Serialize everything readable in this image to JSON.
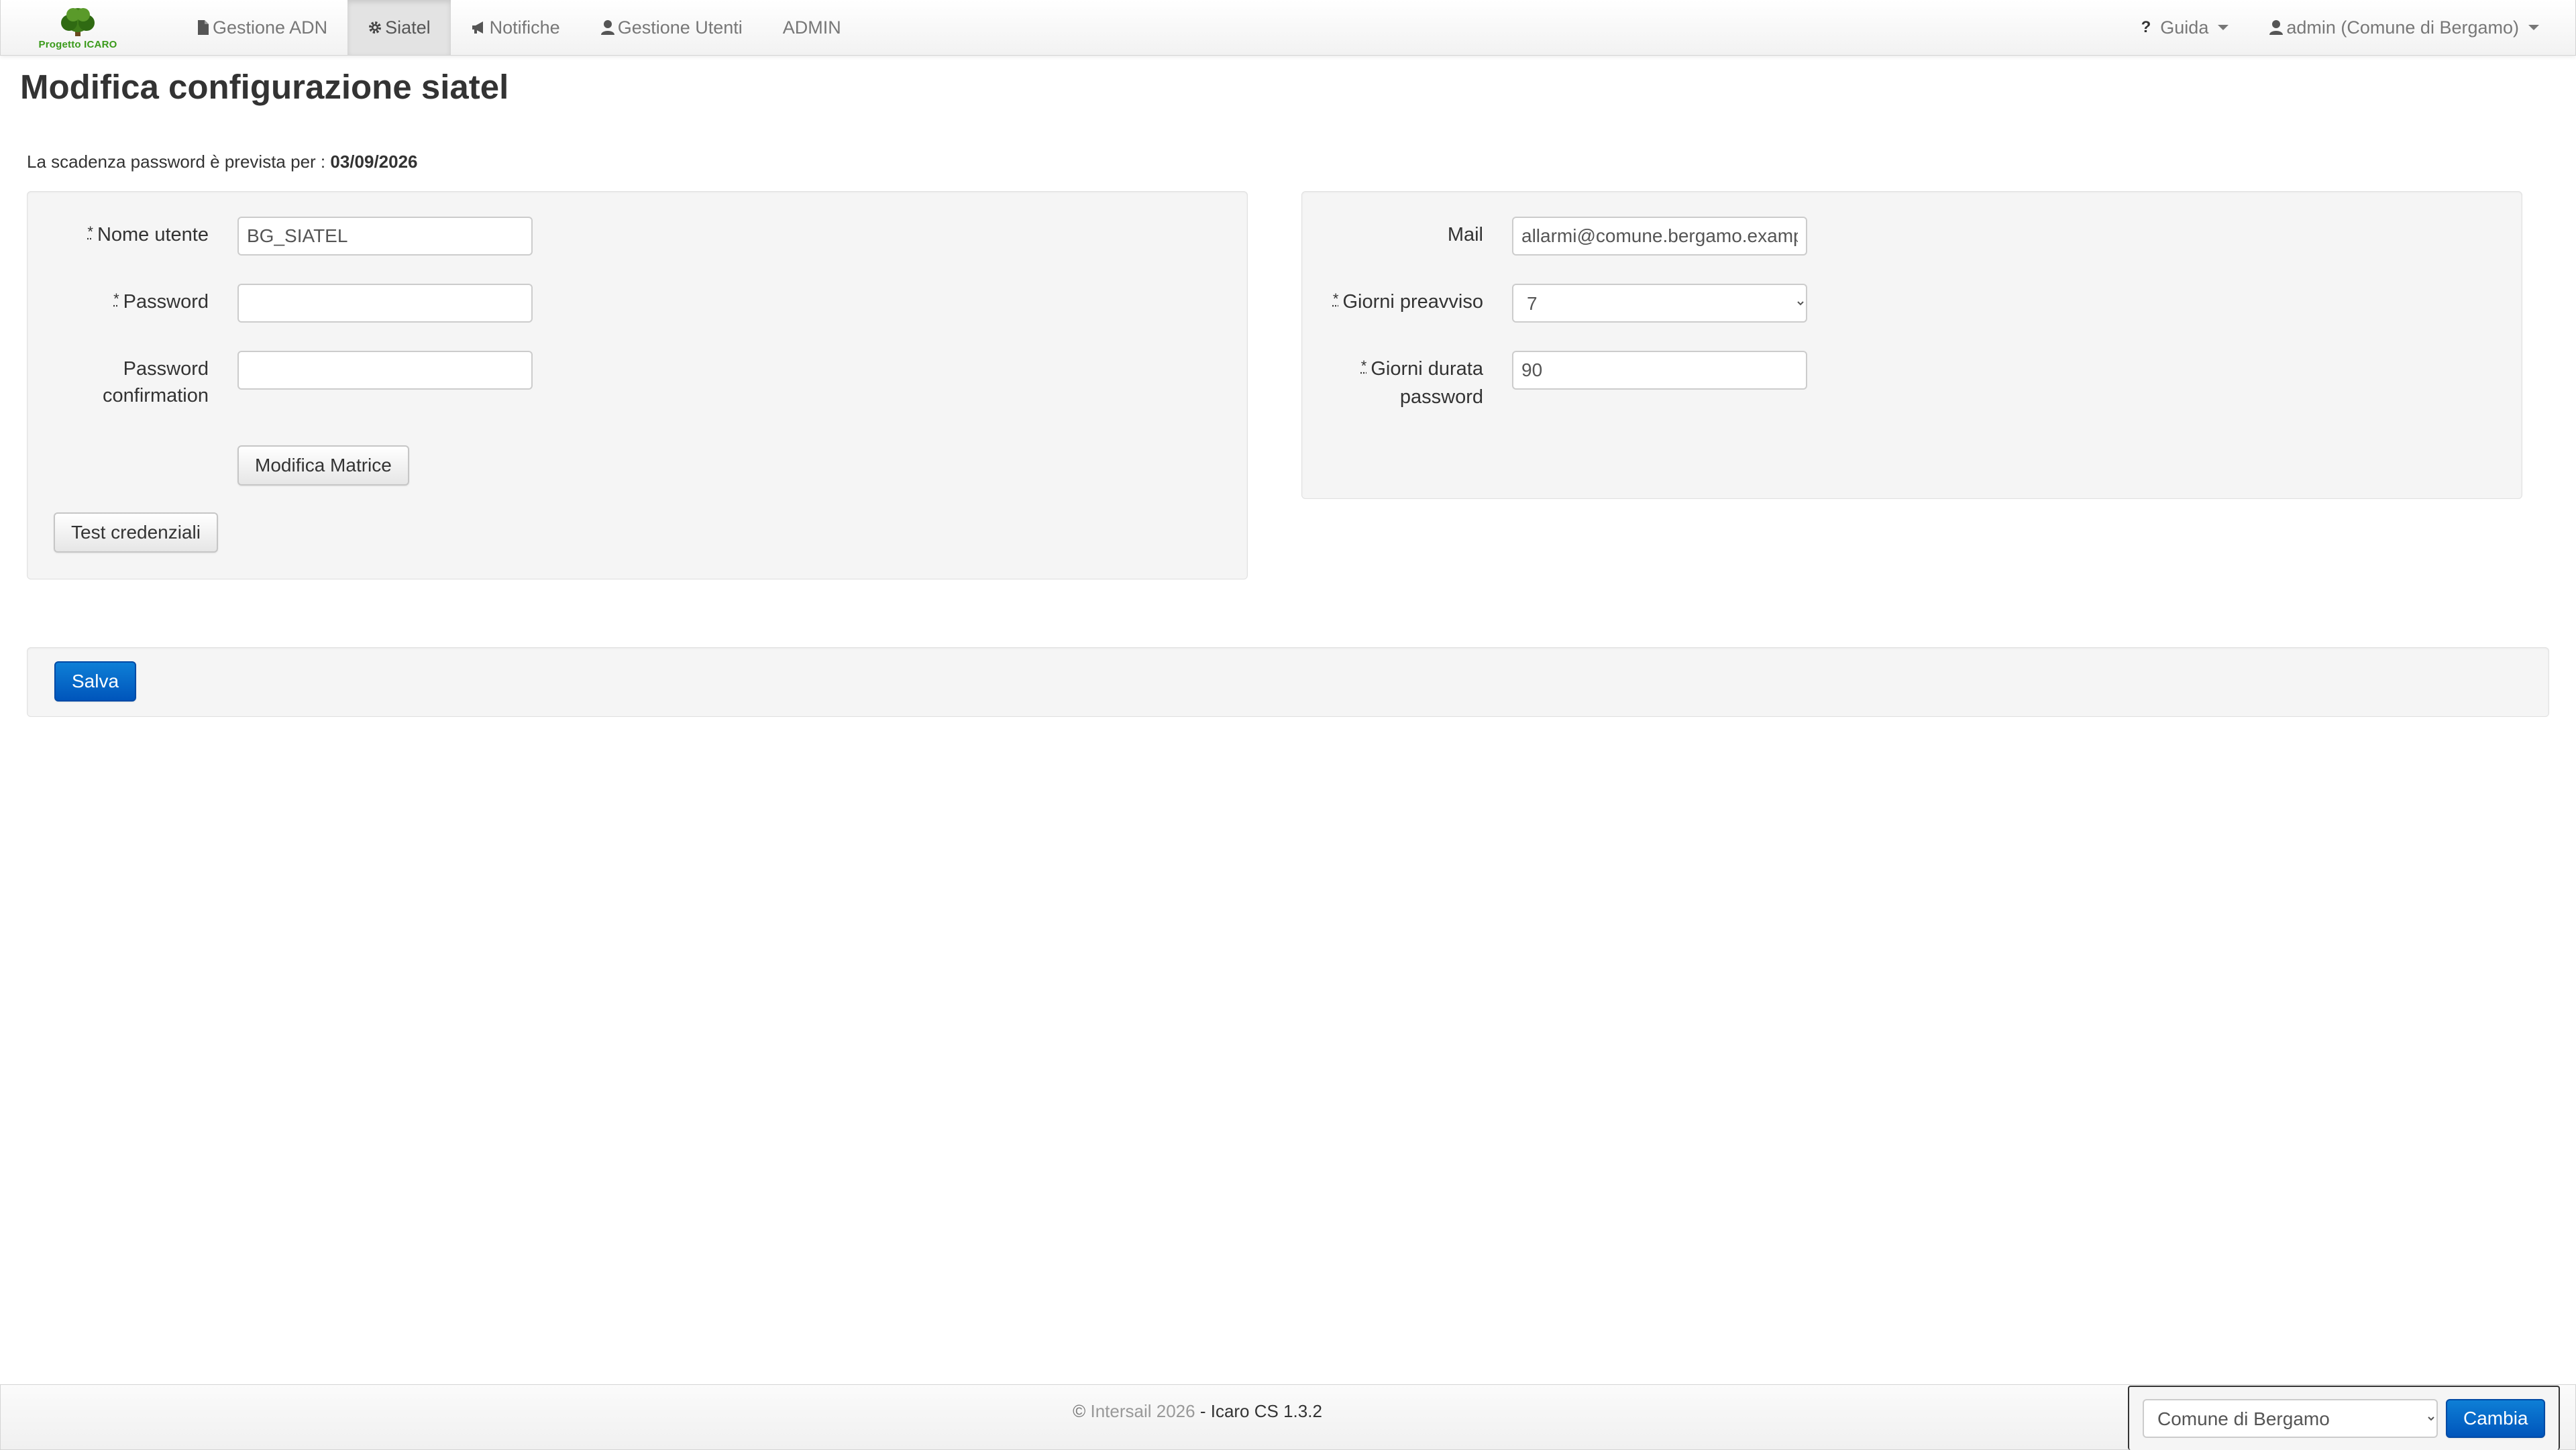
{
  "navbar": {
    "brand_text": "Progetto ICARO",
    "items": [
      {
        "label": "Gestione ADN",
        "icon": "file-icon"
      },
      {
        "label": "Siatel",
        "icon": "gear-icon",
        "active": true
      },
      {
        "label": "Notifiche",
        "icon": "bullhorn-icon"
      },
      {
        "label": "Gestione Utenti",
        "icon": "user-icon"
      },
      {
        "label": "ADMIN"
      }
    ],
    "help_label": "Guida",
    "user_label": "admin (Comune di Bergamo)"
  },
  "page": {
    "title": "Modifica configurazione siatel",
    "expiry_label": "La scadenza password è prevista per :",
    "expiry_date": "03/09/2026"
  },
  "form_left": {
    "required_marker": "*",
    "username_label": "Nome utente",
    "username_value": "BG_SIATEL",
    "password_label": "Password",
    "password_value": "",
    "confirm_label_1": "Password",
    "confirm_label_2": "confirmation",
    "confirm_value": "",
    "matrix_button": "Modifica Matrice",
    "test_button": "Test credenziali"
  },
  "form_right": {
    "required_marker": "*",
    "mail_label": "Mail",
    "mail_value": "allarmi@comune.bergamo.example",
    "notice_days_label": "Giorni preavviso",
    "notice_days_value": "7",
    "duration_label_1": "Giorni durata",
    "duration_label_2": "password",
    "duration_value": "90"
  },
  "actions": {
    "save_button": "Salva"
  },
  "footer": {
    "copyright": "©",
    "company": "Intersail 2026",
    "separator": "-",
    "product": "Icaro CS 1.3.2",
    "comune_select": "Comune di Bergamo",
    "change_button": "Cambia"
  },
  "colors": {
    "primary": "#0063c6",
    "logo_green": "#3a9a1a"
  }
}
